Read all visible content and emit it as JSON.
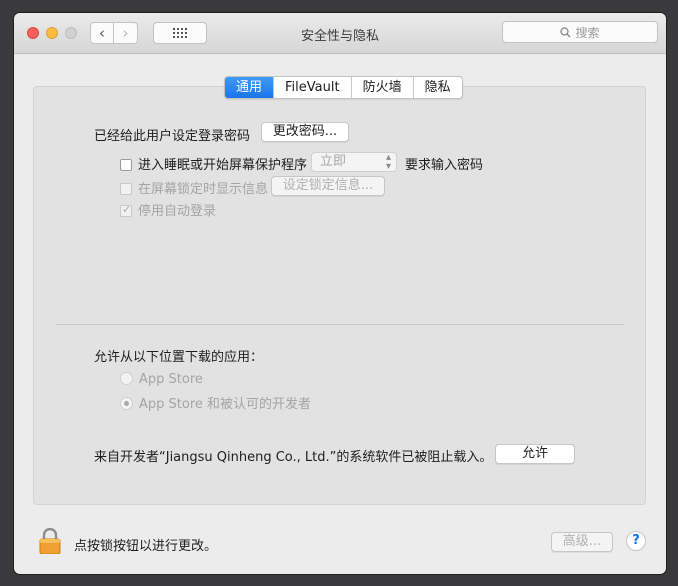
{
  "window": {
    "title": "安全性与隐私"
  },
  "search": {
    "placeholder": "搜索"
  },
  "tabs": [
    {
      "label": "通用",
      "active": true
    },
    {
      "label": "FileVault",
      "active": false
    },
    {
      "label": "防火墙",
      "active": false
    },
    {
      "label": "隐私",
      "active": false
    }
  ],
  "general": {
    "password_label": "已经给此用户设定登录密码",
    "change_password_button": "更改密码...",
    "sleep_checkbox_label": "进入睡眠或开始屏幕保护程序",
    "sleep_select_value": "立即",
    "sleep_suffix": "要求输入密码",
    "lock_message_checkbox_label": "在屏幕锁定时显示信息",
    "set_lock_message_button": "设定锁定信息...",
    "disable_autologin_label": "停用自动登录"
  },
  "downloads": {
    "heading": "允许从以下位置下载的应用：",
    "options": [
      {
        "label": "App Store",
        "selected": false
      },
      {
        "label": "App Store 和被认可的开发者",
        "selected": true
      }
    ],
    "blocked_message": "来自开发者“Jiangsu Qinheng Co., Ltd.”的系统软件已被阻止载入。",
    "allow_button": "允许"
  },
  "footer": {
    "lock_text": "点按锁按钮以进行更改。",
    "advanced_button": "高级...",
    "help_button": "?"
  },
  "colors": {
    "accent": "#1b74ea",
    "lock": "#f0a030"
  }
}
